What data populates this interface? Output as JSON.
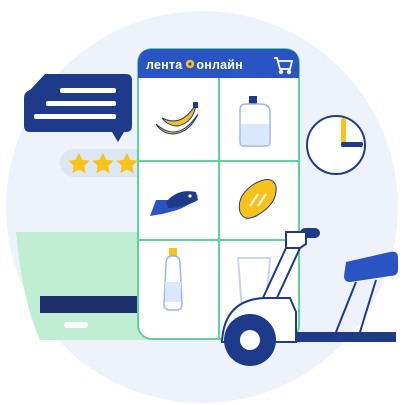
{
  "app": {
    "brand_left": "лента",
    "brand_right": "онлайн"
  },
  "review": {
    "rating": 5,
    "max_rating": 5
  },
  "grid_items": [
    {
      "name": "bananas-icon"
    },
    {
      "name": "milk-jug-icon"
    },
    {
      "name": "fish-icon"
    },
    {
      "name": "bread-loaf-icon"
    },
    {
      "name": "water-bottle-icon"
    },
    {
      "name": "glass-icon"
    }
  ],
  "icons": {
    "cart": "cart-icon",
    "clock": "clock-icon",
    "scooter": "scooter-icon",
    "chat": "chat-bubble-icon",
    "truck": "truck-icon"
  },
  "colors": {
    "navy": "#1e3a8a",
    "blue": "#2a53c4",
    "mint": "#bfeed3",
    "bg_circle": "#eef3fb",
    "yellow": "#f7c21a",
    "phone_border": "#5fd39a"
  }
}
